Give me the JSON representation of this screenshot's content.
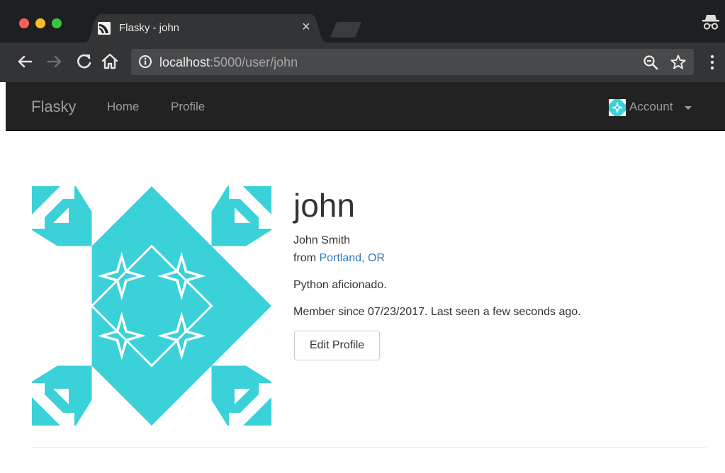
{
  "browser": {
    "tab_title": "Flasky - john",
    "tab_close_glyph": "×",
    "url_host": "localhost",
    "url_rest": ":5000/user/john",
    "icons": [
      "back-arrow-icon",
      "forward-arrow-icon",
      "reload-icon",
      "home-icon",
      "info-icon",
      "zoom-icon",
      "star-icon",
      "menu-dots-icon",
      "incognito-icon",
      "new-tab-icon"
    ]
  },
  "navbar": {
    "brand": "Flasky",
    "links": [
      "Home",
      "Profile"
    ],
    "account_label": "Account",
    "background": "#222222",
    "link_color": "#9d9d9d"
  },
  "profile": {
    "username": "john",
    "full_name": "John Smith",
    "from_prefix": "from",
    "location": "Portland, OR",
    "about": "Python aficionado.",
    "member_since": "Member since 07/23/2017. Last seen a few seconds ago.",
    "edit_button": "Edit Profile",
    "identicon_color": "#3bd1d9",
    "link_color": "#337ab7"
  }
}
